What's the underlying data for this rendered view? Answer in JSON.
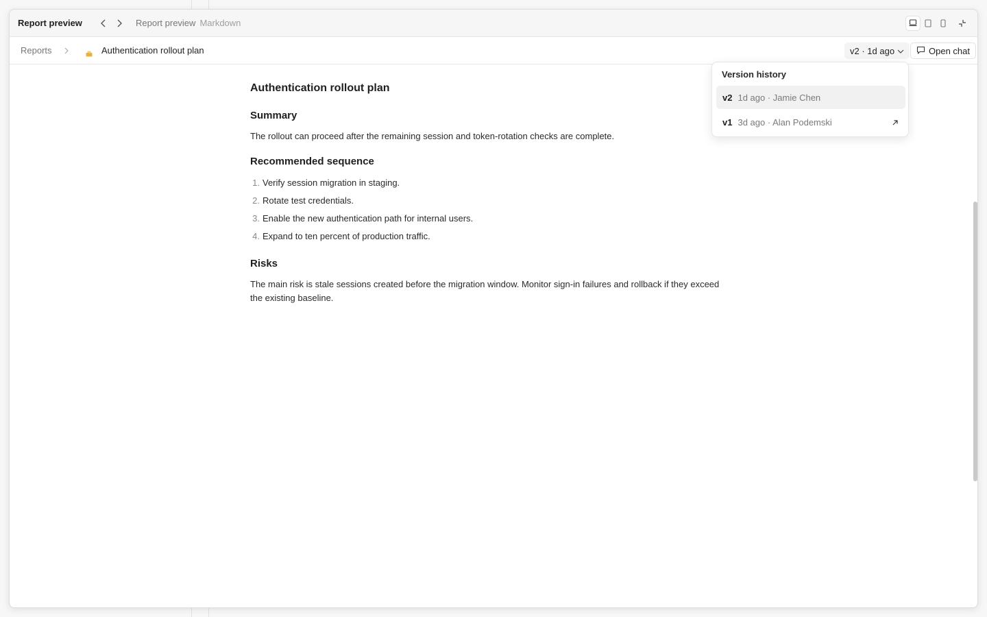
{
  "header": {
    "title": "Report preview",
    "crumb_title": "Report preview",
    "crumb_format": "Markdown"
  },
  "toolbar": {
    "breadcrumb_root": "Reports",
    "breadcrumb_current": "Authentication rollout plan",
    "version_label": "v2 · 1d ago",
    "open_chat_label": "Open chat"
  },
  "document": {
    "title": "Authentication rollout plan",
    "sections": [
      {
        "heading": "Summary",
        "text": "The rollout can proceed after the remaining session and token-rotation checks are complete."
      },
      {
        "heading": "Recommended sequence",
        "items": [
          "Verify session migration in staging.",
          "Rotate test credentials.",
          "Enable the new authentication path for internal users.",
          "Expand to ten percent of production traffic."
        ]
      },
      {
        "heading": "Risks",
        "text": "The main risk is stale sessions created before the migration window. Monitor sign-in failures and rollback if they exceed the existing baseline."
      }
    ],
    "list_numbers": [
      "1.",
      "2.",
      "3.",
      "4."
    ]
  },
  "version_history": {
    "title": "Version history",
    "items": [
      {
        "version": "v2",
        "meta": "1d ago · Jamie Chen",
        "selected": true
      },
      {
        "version": "v1",
        "meta": "3d ago · Alan Podemski",
        "selected": false
      }
    ]
  },
  "icons": {
    "back": "chevron-left-icon",
    "forward": "chevron-right-icon",
    "breadcrumb_separator": "chevron-right-icon",
    "doc": "report-doc-icon",
    "version_dropdown": "chevron-down-icon",
    "chat": "chat-bubble-icon",
    "external": "arrow-up-right-icon",
    "views": [
      "layout-desktop-icon",
      "layout-tablet-icon",
      "layout-mobile-icon"
    ],
    "collapse": "minimize-icon"
  },
  "colors": {
    "doc_icon": "#e8b23a",
    "selected_row": "#f1f1f1"
  }
}
